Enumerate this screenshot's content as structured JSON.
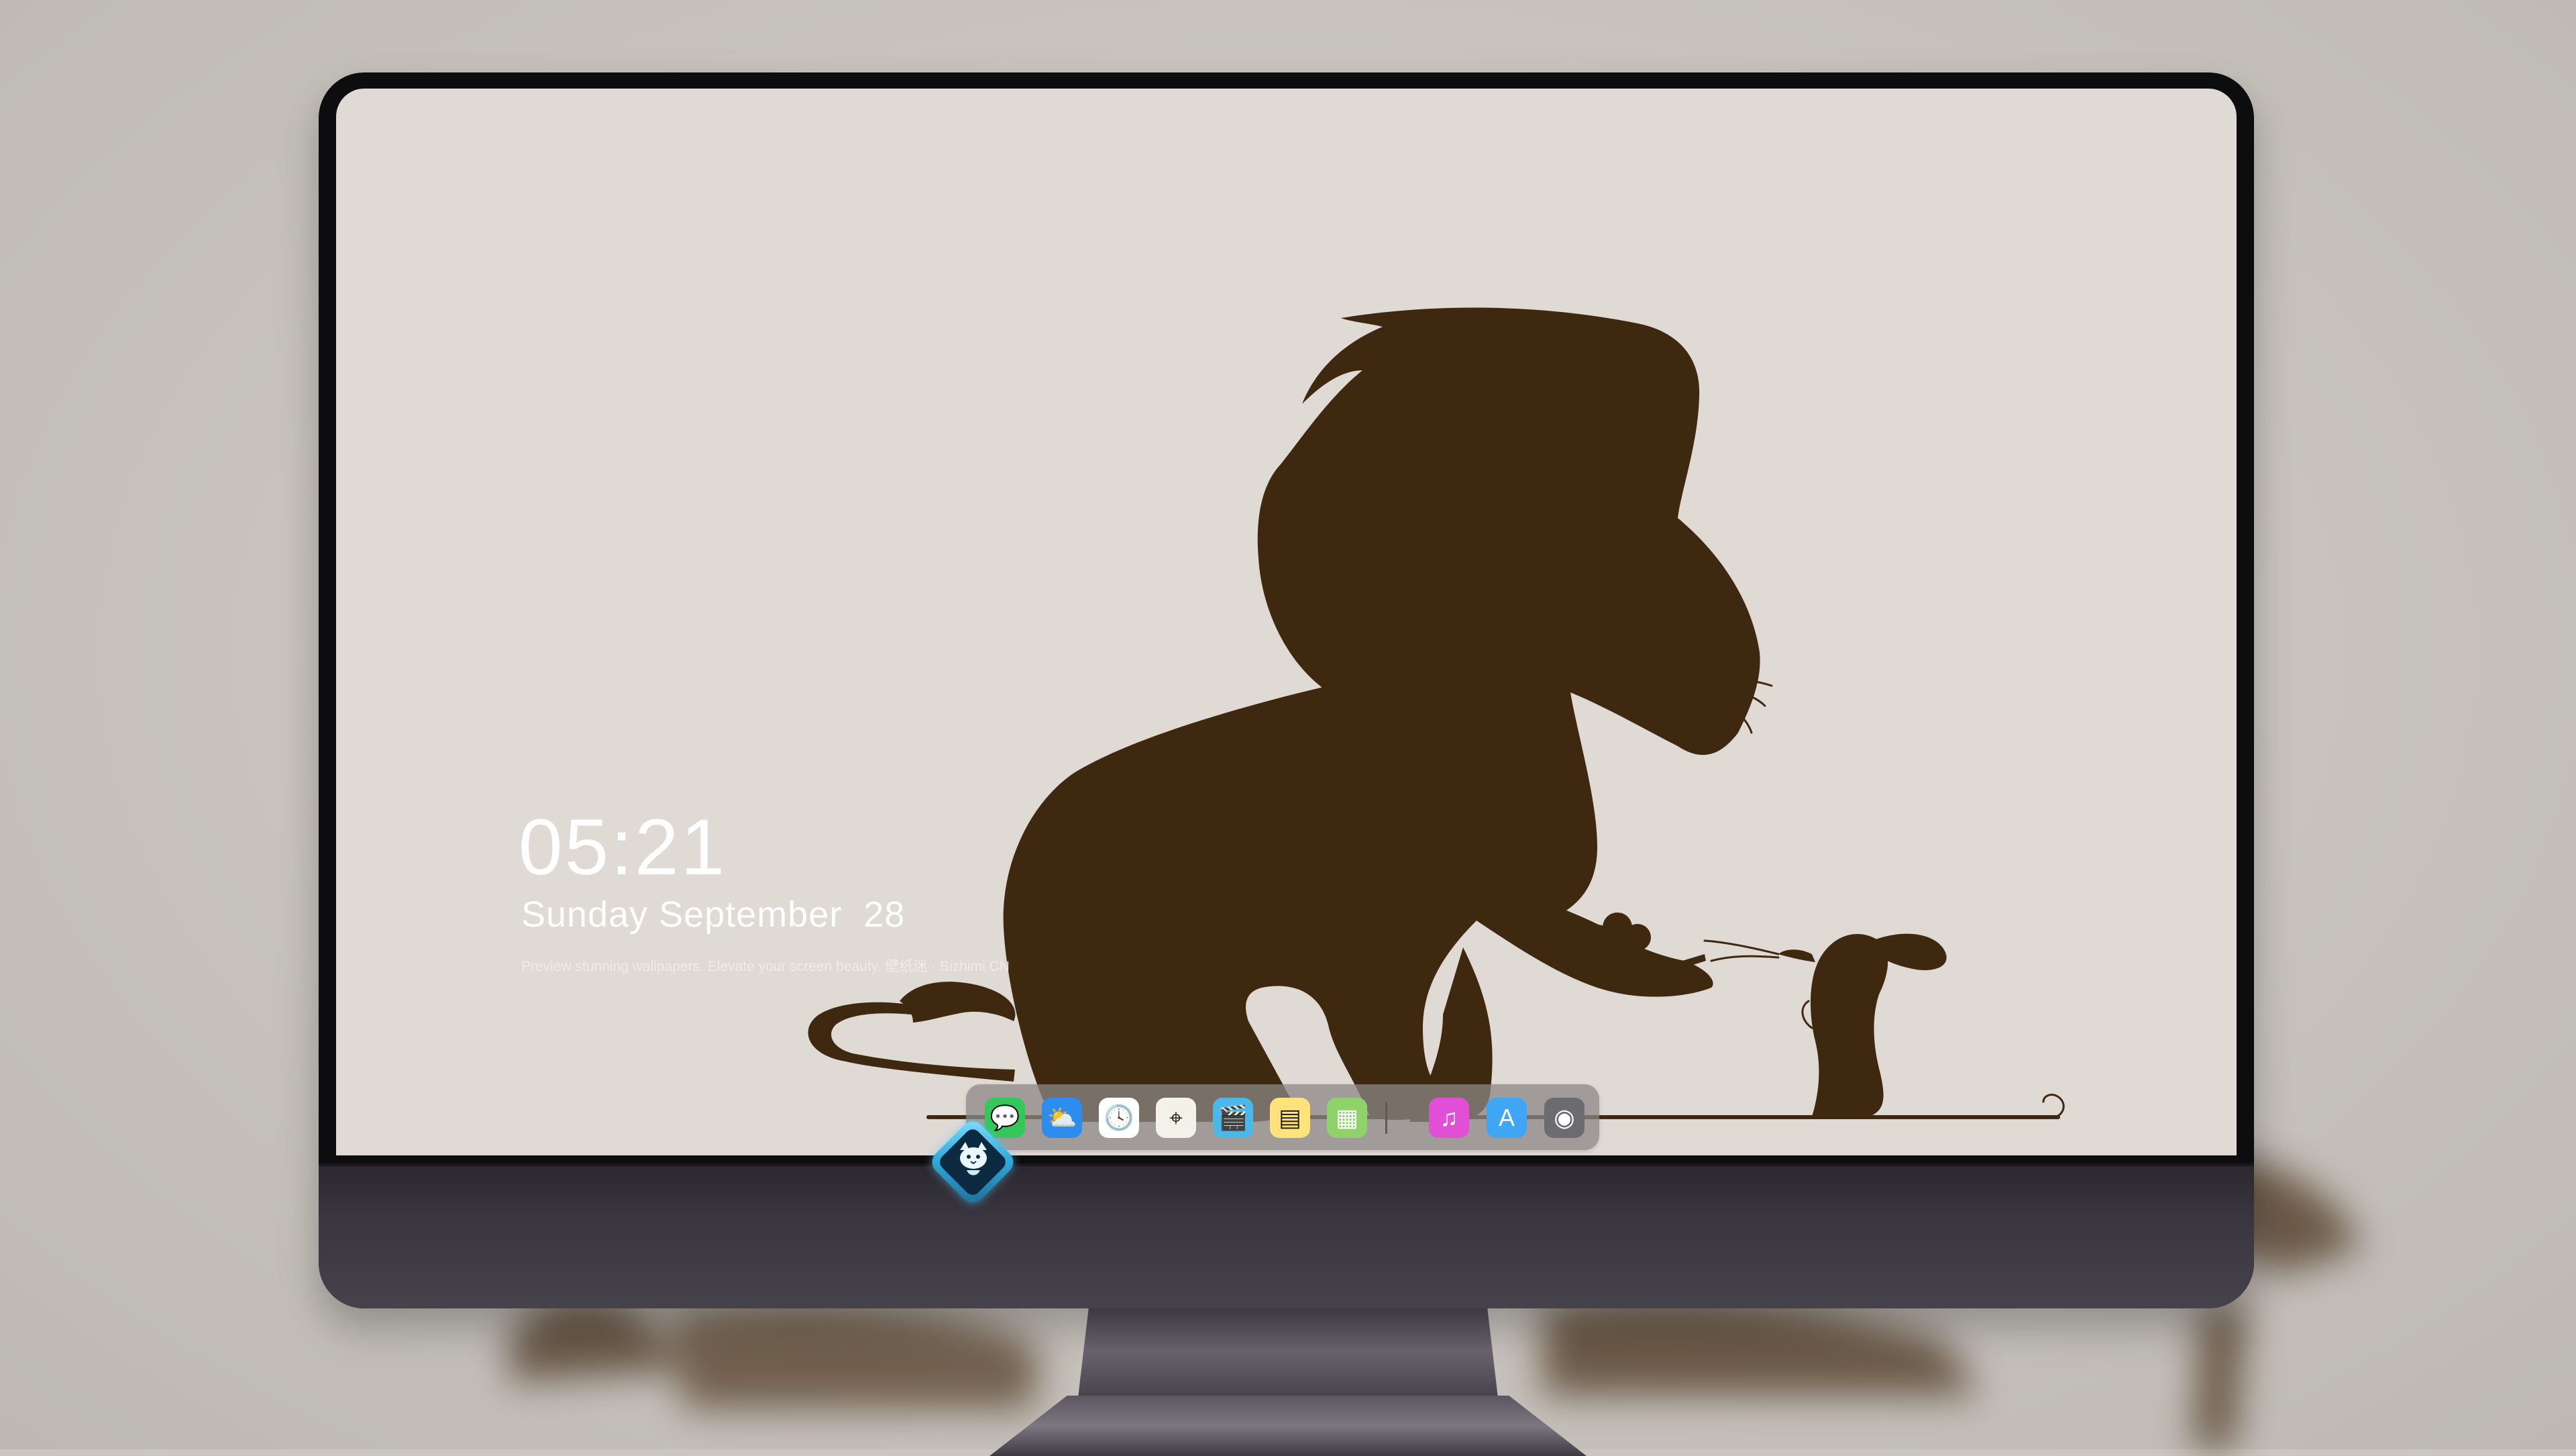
{
  "lock_screen": {
    "time": "05:21",
    "date": "Sunday September  28",
    "caption": "Preview stunning wallpapers. Elevate your screen beauty. 壁纸迷 · Bizhimi CN"
  },
  "wallpaper": {
    "subject": "lion-and-mouse-silhouette",
    "background_color": "#e0dad5",
    "silhouette_color": "#3e2810"
  },
  "dock": {
    "apps": [
      {
        "name": "messages-icon",
        "color": "#34c759",
        "glyph": "💬"
      },
      {
        "name": "weather-icon",
        "color": "#2d8cf0",
        "glyph": "⛅"
      },
      {
        "name": "clock-icon",
        "color": "#ffffff",
        "glyph": "🕓"
      },
      {
        "name": "maps-icon",
        "color": "#f4f1e8",
        "glyph": "⌖"
      },
      {
        "name": "clips-icon",
        "color": "#4ab8e8",
        "glyph": "🎬"
      },
      {
        "name": "notes-icon",
        "color": "#ffe27a",
        "glyph": "▤"
      },
      {
        "name": "photos-app-icon",
        "color": "#8fd16a",
        "glyph": "▦"
      },
      {
        "name": "itunes-icon",
        "color": "#e04fd6",
        "glyph": "♫"
      },
      {
        "name": "app-store-icon",
        "color": "#3fa6f5",
        "glyph": "A"
      },
      {
        "name": "camera-icon",
        "color": "#6c6c70",
        "glyph": "◉"
      }
    ]
  },
  "monitor": {
    "bezel_color": "#0d0c0f",
    "chin_color": "#3b3741",
    "logo": "cat-mascot-logo"
  }
}
